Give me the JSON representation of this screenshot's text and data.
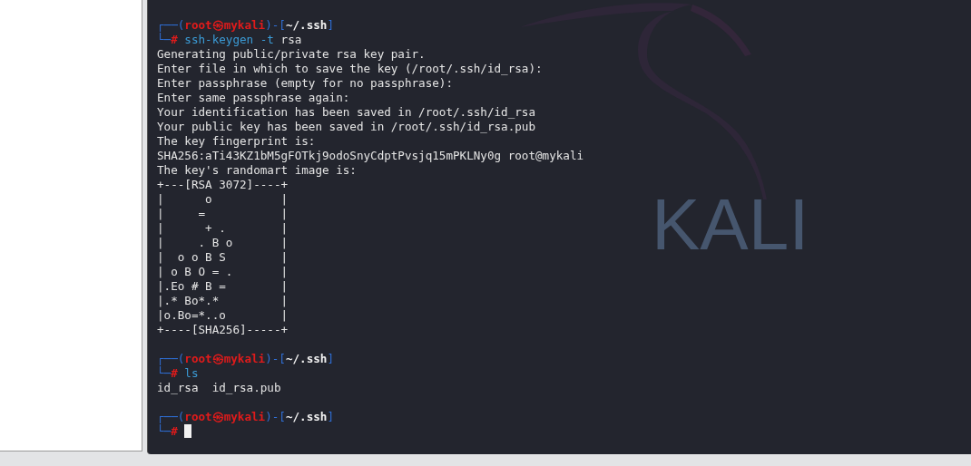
{
  "wallpaper": {
    "logo_text": "KALI"
  },
  "terminal": {
    "blocks": [
      {
        "kind": "prompt",
        "open": "┌──(",
        "user_host": "root㉿mykali",
        "mid": ")-[",
        "path": "~/.ssh",
        "close": "]",
        "corner": "└─",
        "symbol": "#",
        "command": [
          {
            "kind": "program",
            "text": "ssh-keygen"
          },
          {
            "kind": "option",
            "text": "-t"
          },
          {
            "kind": "arg",
            "text": "rsa"
          }
        ],
        "cursor": false
      },
      {
        "kind": "output",
        "lines": [
          "Generating public/private rsa key pair.",
          "Enter file in which to save the key (/root/.ssh/id_rsa):",
          "Enter passphrase (empty for no passphrase):",
          "Enter same passphrase again:",
          "Your identification has been saved in /root/.ssh/id_rsa",
          "Your public key has been saved in /root/.ssh/id_rsa.pub",
          "The key fingerprint is:",
          "SHA256:aTi43KZ1bM5gFOTkj9odoSnyCdptPvsjq15mPKLNy0g root@mykali",
          "The key's randomart image is:",
          "+---[RSA 3072]----+",
          "|      o          |",
          "|     =           |",
          "|      + .        |",
          "|     . B o       |",
          "|  o o B S        |",
          "| o B O = .       |",
          "|.Eo # B =        |",
          "|.* Bo*.*         |",
          "|o.Bo=*..o        |",
          "+----[SHA256]-----+"
        ]
      },
      {
        "kind": "blank"
      },
      {
        "kind": "prompt",
        "open": "┌──(",
        "user_host": "root㉿mykali",
        "mid": ")-[",
        "path": "~/.ssh",
        "close": "]",
        "corner": "└─",
        "symbol": "#",
        "command": [
          {
            "kind": "program",
            "text": "ls"
          }
        ],
        "cursor": false
      },
      {
        "kind": "output",
        "lines": [
          "id_rsa  id_rsa.pub"
        ]
      },
      {
        "kind": "blank"
      },
      {
        "kind": "prompt",
        "open": "┌──(",
        "user_host": "root㉿mykali",
        "mid": ")-[",
        "path": "~/.ssh",
        "close": "]",
        "corner": "└─",
        "symbol": "#",
        "cursor": true
      }
    ]
  }
}
